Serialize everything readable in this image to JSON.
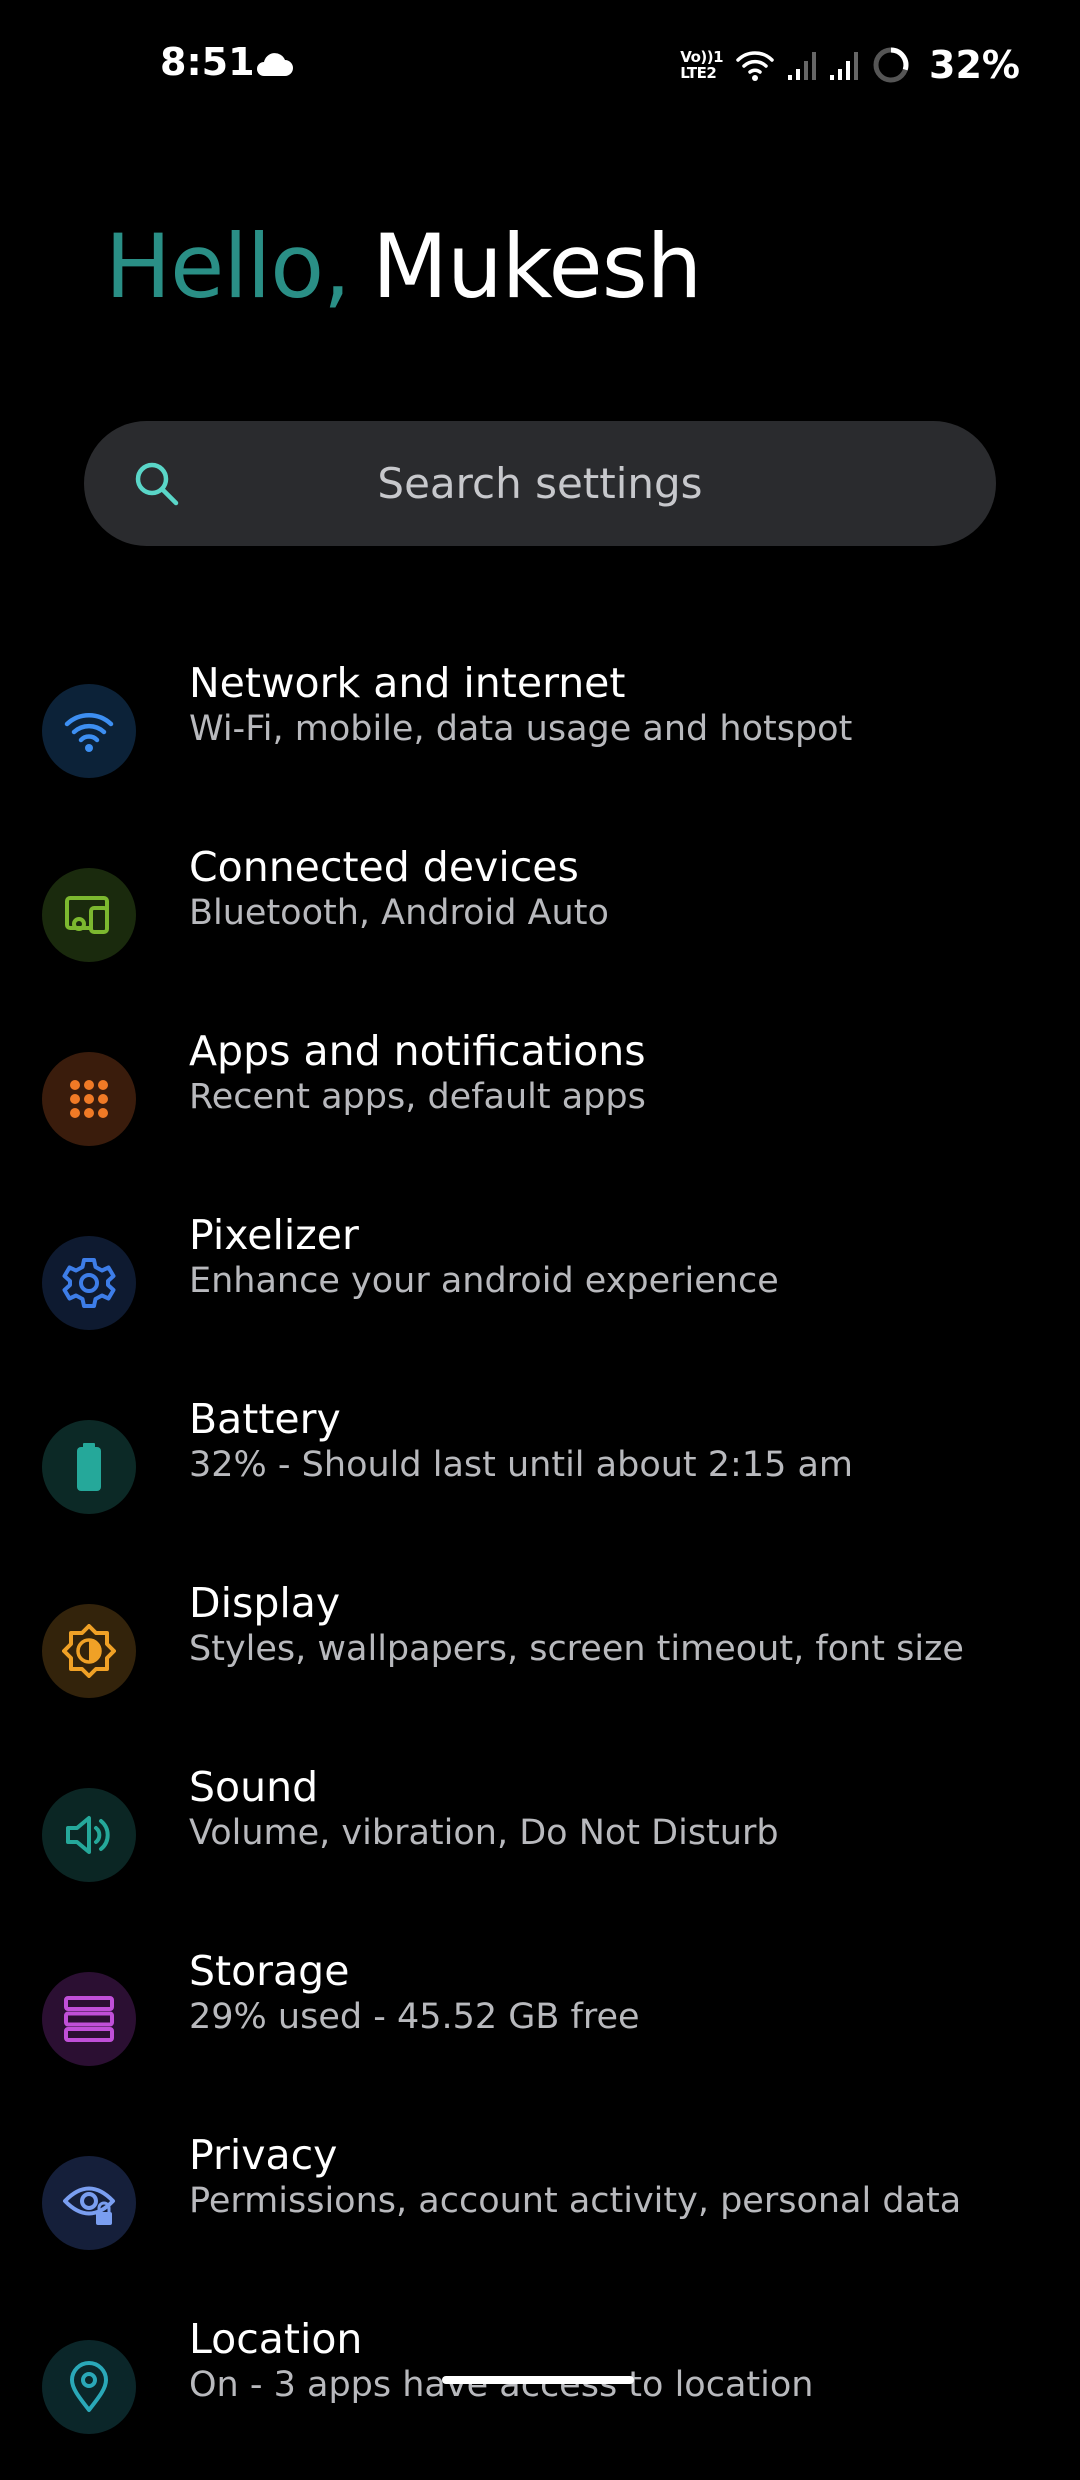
{
  "status_bar": {
    "time": "8:51",
    "weather_icon": "cloud-icon",
    "volte_top": "Vo))1",
    "volte_bottom": "LTE2",
    "battery_percent": "32%"
  },
  "greeting": {
    "hello": "Hello,",
    "name": "Mukesh"
  },
  "search": {
    "placeholder": "Search settings"
  },
  "settings": [
    {
      "title": "Network and internet",
      "summary": "Wi-Fi, mobile, data usage and hotspot",
      "icon": "wifi-icon",
      "color": "#3d8ff2",
      "bg": "#0c2238"
    },
    {
      "title": "Connected devices",
      "summary": "Bluetooth, Android Auto",
      "icon": "devices-icon",
      "color": "#7cb82f",
      "bg": "#1a2a0d"
    },
    {
      "title": "Apps and notifications",
      "summary": "Recent apps, default apps",
      "icon": "apps-grid-icon",
      "color": "#f07a26",
      "bg": "#3a1c0c"
    },
    {
      "title": "Pixelizer",
      "summary": "Enhance your android experience",
      "icon": "gear-icon",
      "color": "#3d7de8",
      "bg": "#0e1a30"
    },
    {
      "title": "Battery",
      "summary": "32% - Should last until about 2:15 am",
      "icon": "battery-icon",
      "color": "#25a89a",
      "bg": "#0c2926"
    },
    {
      "title": "Display",
      "summary": "Styles, wallpapers, screen timeout, font size",
      "icon": "brightness-icon",
      "color": "#f0a126",
      "bg": "#33230b"
    },
    {
      "title": "Sound",
      "summary": "Volume, vibration, Do Not Disturb",
      "icon": "volume-icon",
      "color": "#25a89a",
      "bg": "#0b2624"
    },
    {
      "title": "Storage",
      "summary": "29% used - 45.52 GB free",
      "icon": "storage-icon",
      "color": "#c04fd8",
      "bg": "#2b0f32"
    },
    {
      "title": "Privacy",
      "summary": "Permissions, account activity, personal data",
      "icon": "privacy-eye-icon",
      "color": "#7a9ef0",
      "bg": "#151f3a"
    },
    {
      "title": "Location",
      "summary": "On - 3 apps have access to location",
      "icon": "location-pin-icon",
      "color": "#2aa8b8",
      "bg": "#0b2629"
    }
  ]
}
